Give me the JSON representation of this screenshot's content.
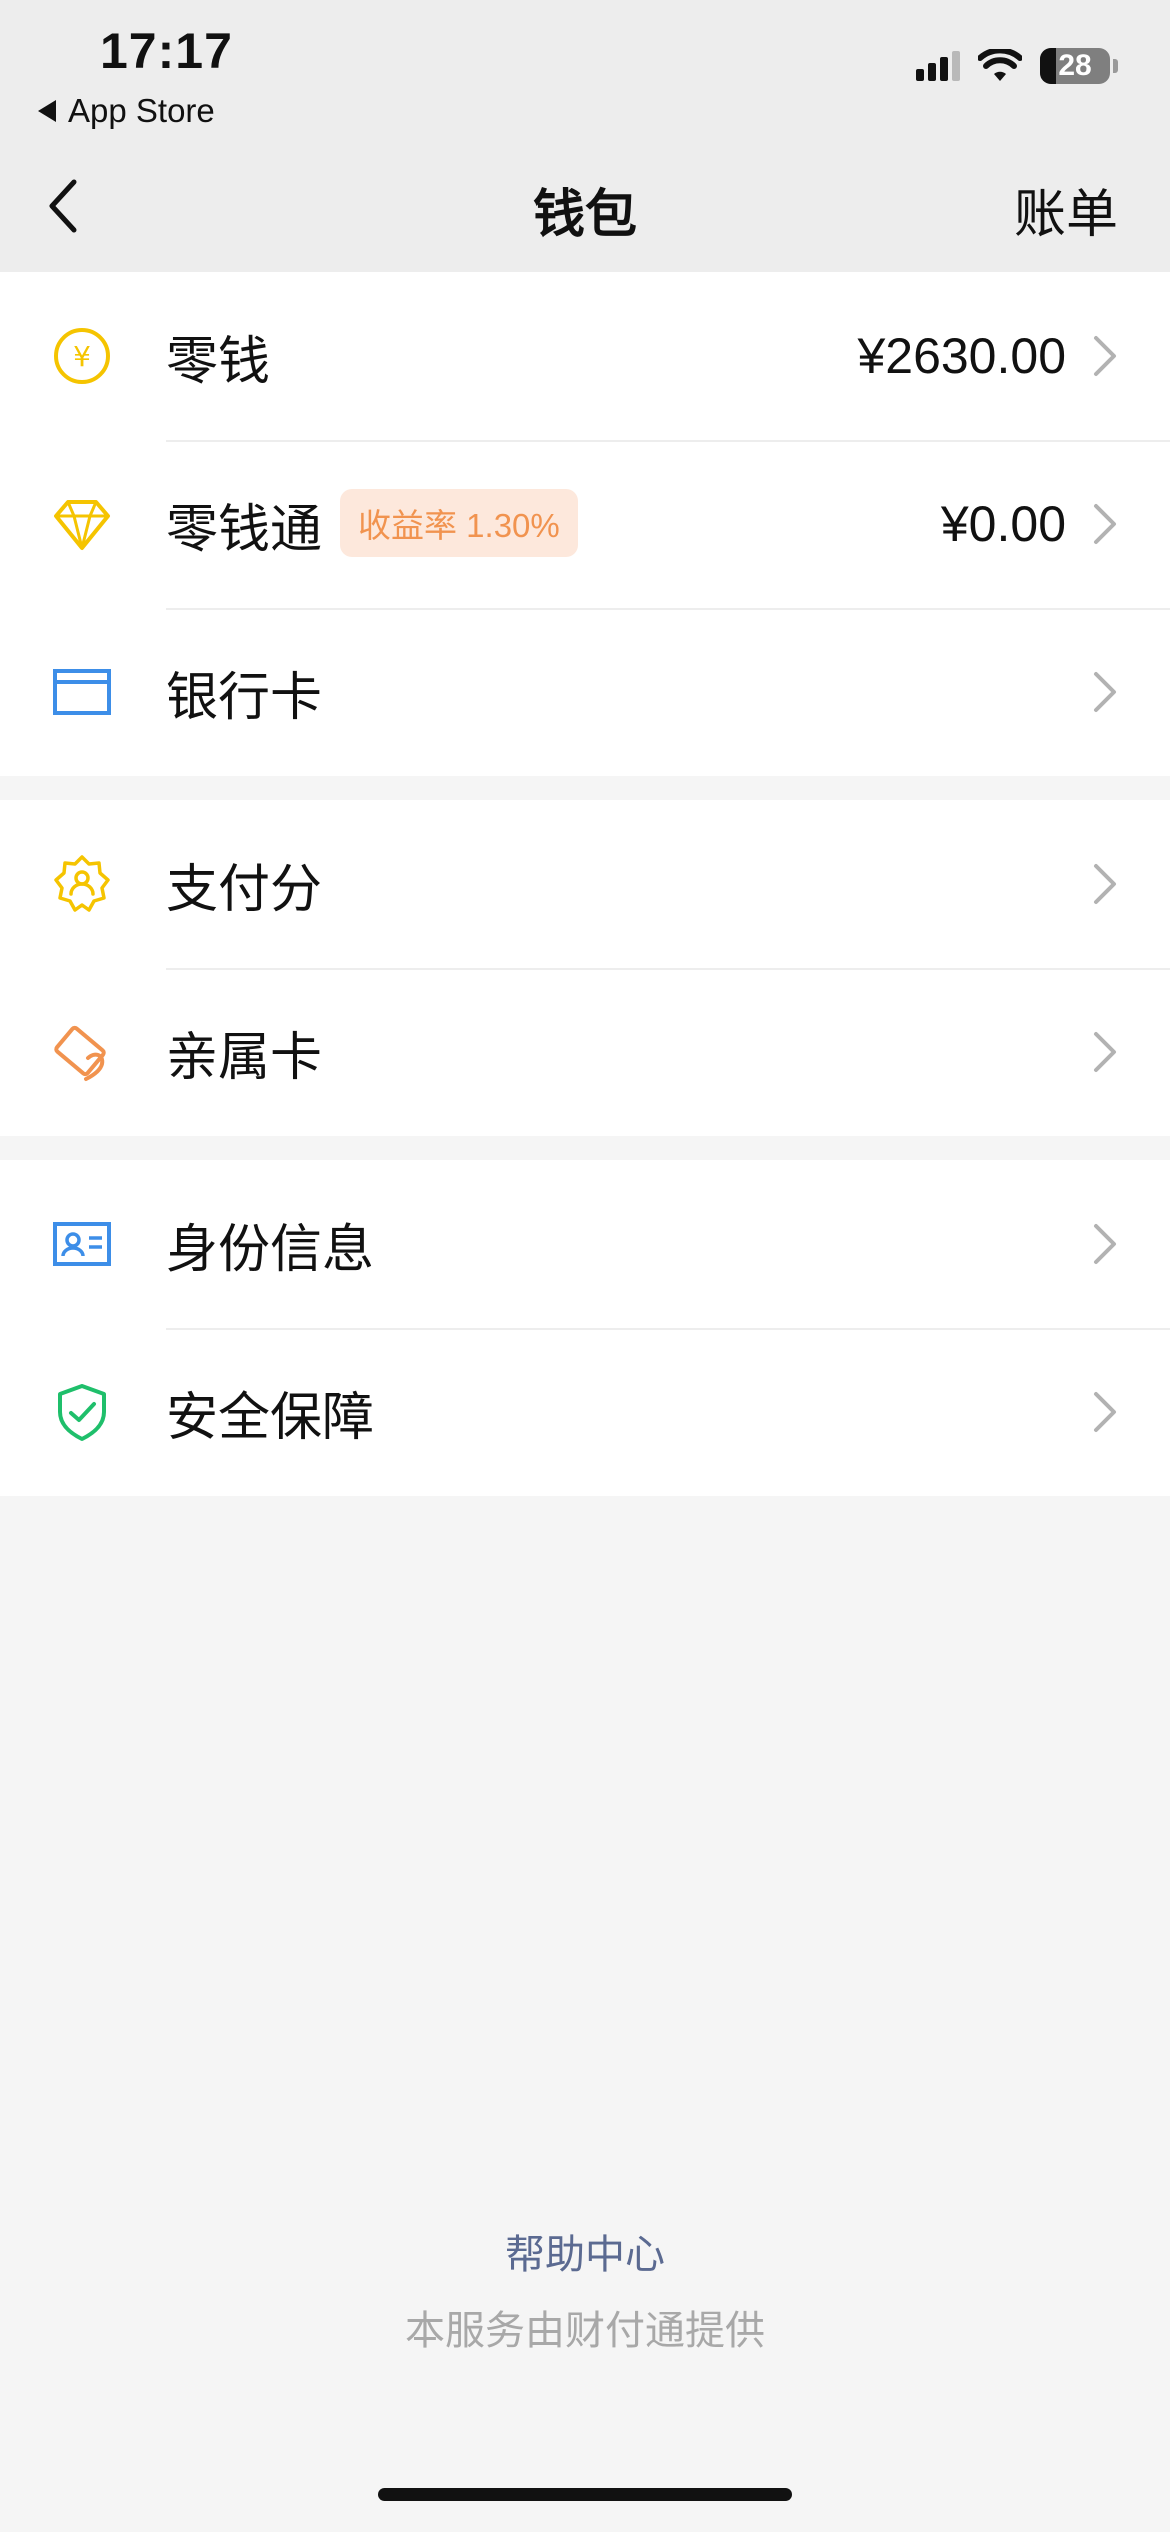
{
  "status_bar": {
    "time": "17:17",
    "back_app": "App Store",
    "battery": "28"
  },
  "nav": {
    "title": "钱包",
    "bills": "账单"
  },
  "groups": [
    {
      "items": [
        {
          "label": "零钱",
          "value": "¥2630.00",
          "icon": "yuan-coin-icon",
          "icon_color": "#f5c400"
        },
        {
          "label": "零钱通",
          "value": "¥0.00",
          "badge": "收益率 1.30%",
          "icon": "diamond-icon",
          "icon_color": "#f5c400"
        },
        {
          "label": "银行卡",
          "icon": "bank-card-icon",
          "icon_color": "#3d8ee8"
        }
      ]
    },
    {
      "items": [
        {
          "label": "支付分",
          "icon": "pay-score-badge-icon",
          "icon_color": "#f5c400"
        },
        {
          "label": "亲属卡",
          "icon": "family-card-icon",
          "icon_color": "#f1934f"
        }
      ]
    },
    {
      "items": [
        {
          "label": "身份信息",
          "icon": "id-card-icon",
          "icon_color": "#3d8ee8"
        },
        {
          "label": "安全保障",
          "icon": "shield-check-icon",
          "icon_color": "#1fbf6b"
        }
      ]
    }
  ],
  "footer": {
    "help": "帮助中心",
    "provider": "本服务由财付通提供"
  },
  "colors": {
    "header_bg": "#ededed",
    "page_bg": "#f5f5f5",
    "link": "#5b6a91",
    "badge_bg": "#fde8dc",
    "badge_text": "#f1934f"
  }
}
